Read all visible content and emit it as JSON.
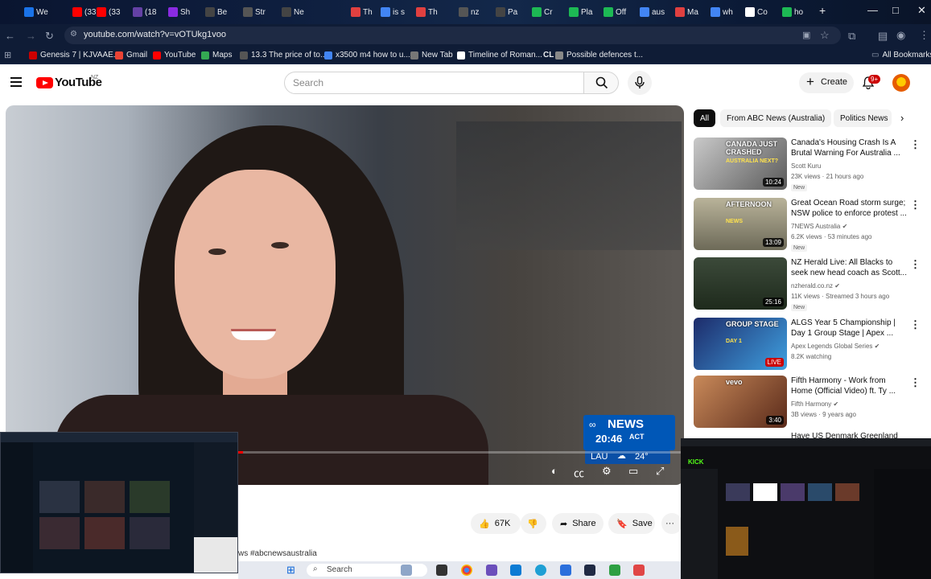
{
  "browser": {
    "tabs": [
      {
        "label": "We",
        "color": "#1a73e8"
      },
      {
        "label": "(33",
        "color": "#ff0000"
      },
      {
        "label": "(33",
        "color": "#ff0000"
      },
      {
        "label": "(18",
        "color": "#6441a5"
      },
      {
        "label": "Sh",
        "color": "#8a2be2"
      },
      {
        "label": "Be",
        "color": "#444"
      },
      {
        "label": "Str",
        "color": "#555"
      },
      {
        "label": "Ne",
        "color": "#444"
      },
      {
        "label": "Th",
        "color": "#e04040"
      },
      {
        "label": "is s",
        "color": "#4285f4"
      },
      {
        "label": "Th",
        "color": "#e04040"
      },
      {
        "label": "nz",
        "color": "#555"
      },
      {
        "label": "Pa",
        "color": "#444"
      },
      {
        "label": "Cr",
        "color": "#1db954"
      },
      {
        "label": "Pla",
        "color": "#1db954"
      },
      {
        "label": "Off",
        "color": "#1db954"
      },
      {
        "label": "aus",
        "color": "#4285f4"
      },
      {
        "label": "Ma",
        "color": "#e04040"
      },
      {
        "label": "wh",
        "color": "#4285f4"
      },
      {
        "label": "Co",
        "color": "#fff"
      },
      {
        "label": "ho",
        "color": "#1db954"
      }
    ],
    "window_controls": {
      "minimize": "—",
      "maximize": "□",
      "close": "✕"
    },
    "url": "youtube.com/watch?v=vOTUkg1voo",
    "bookmarks": [
      {
        "label": "Genesis 7 | KJVAAE...",
        "color": "#cc0000"
      },
      {
        "label": "Gmail",
        "color": "#ea4335"
      },
      {
        "label": "YouTube",
        "color": "#ff0000"
      },
      {
        "label": "Maps",
        "color": "#34a853"
      },
      {
        "label": "13.3 The price of to...",
        "color": "#555"
      },
      {
        "label": "x3500 m4 how to u...",
        "color": "#4285f4"
      },
      {
        "label": "New Tab",
        "color": "#777"
      },
      {
        "label": "Timeline of Roman...",
        "color": "#fff"
      },
      {
        "label": "Possible defences t...",
        "color": "#888"
      }
    ],
    "bookmarks_prefix": "CL",
    "all_bookmarks": "All Bookmarks"
  },
  "youtube": {
    "logo_word": "YouTube",
    "region": "NZ",
    "search_placeholder": "Search",
    "create_label": "Create",
    "notif_badge": "9+",
    "chips": [
      "All",
      "From ABC News (Australia)",
      "Politics News"
    ],
    "player": {
      "news_brand": "NEWS",
      "news_time": "20:46",
      "news_region": "ACT",
      "weather_city": "LAU",
      "weather_temp": "24°",
      "progress_fraction": 0.35
    },
    "actions": {
      "likes": "67K",
      "share": "Share",
      "save": "Save",
      "more": "···"
    },
    "hashtag": "ws #abcnewsaustralia",
    "recommendations": [
      {
        "title": "Canada's Housing Crash Is A Brutal Warning For Australia ...",
        "channel": "Scott Kuru",
        "meta": "23K views · 21 hours ago",
        "badge": "New",
        "duration": "10:24",
        "thumb_text": "CANADA JUST CRASHED",
        "thumb_sub": "AUSTRALIA NEXT?",
        "verified": false
      },
      {
        "title": "Great Ocean Road storm surge; NSW police to enforce protest ...",
        "channel": "7NEWS Australia",
        "meta": "6.2K views · 53 minutes ago",
        "badge": "New",
        "duration": "13:09",
        "thumb_text": "AFTERNOON",
        "thumb_sub": "NEWS",
        "verified": true
      },
      {
        "title": "NZ Herald Live: All Blacks to seek new head coach as Scott...",
        "channel": "nzherald.co.nz",
        "meta": "11K views · Streamed 3 hours ago",
        "badge": "New",
        "duration": "25:16",
        "thumb_text": "",
        "thumb_sub": "",
        "verified": true
      },
      {
        "title": "ALGS Year 5 Championship | Day 1 Group Stage | Apex ...",
        "channel": "Apex Legends Global Series",
        "meta": "8.2K watching",
        "badge": "",
        "duration": "LIVE",
        "thumb_text": "GROUP STAGE",
        "thumb_sub": "DAY 1",
        "verified": true
      },
      {
        "title": "Fifth Harmony - Work from Home (Official Video) ft. Ty ...",
        "channel": "Fifth Harmony",
        "meta": "3B views · 9 years ago",
        "badge": "",
        "duration": "3:40",
        "thumb_text": "vevo",
        "thumb_sub": "",
        "verified": true
      }
    ],
    "partial_rec_title": "Have US Denmark Greenland"
  },
  "overlay_right": {
    "logo": "KICK"
  },
  "taskbar": {
    "search": "Search"
  }
}
